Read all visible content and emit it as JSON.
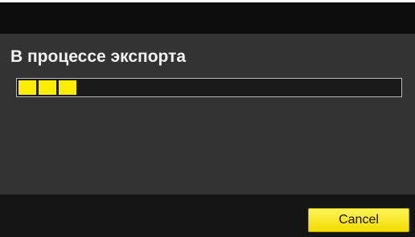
{
  "dialog": {
    "status_title": "В процессе экспорта",
    "progress": {
      "value": 0.15,
      "filled_blocks": 3
    },
    "cancel_label": "Cancel"
  },
  "colors": {
    "accent": "#ffed00",
    "background": "#333333",
    "footer": "#151515"
  }
}
